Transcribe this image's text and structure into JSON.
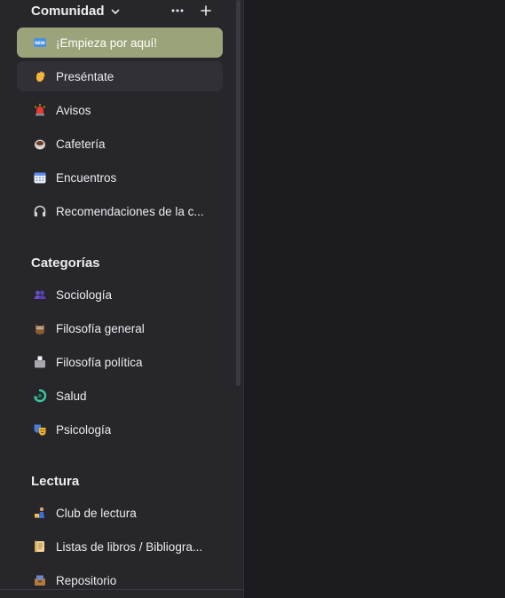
{
  "community": {
    "title": "Comunidad",
    "items": [
      {
        "label": "¡Empieza por aquí!",
        "icon": "new-badge-icon",
        "state": "active"
      },
      {
        "label": "Preséntate",
        "icon": "waving-hand-icon",
        "state": "hover"
      },
      {
        "label": "Avisos",
        "icon": "siren-icon",
        "state": ""
      },
      {
        "label": "Cafetería",
        "icon": "coffee-icon",
        "state": ""
      },
      {
        "label": "Encuentros",
        "icon": "calendar-icon",
        "state": ""
      },
      {
        "label": "Recomendaciones de la c...",
        "icon": "headphones-icon",
        "state": ""
      }
    ]
  },
  "categories": {
    "title": "Categorías",
    "items": [
      {
        "label": "Sociología",
        "icon": "people-icon"
      },
      {
        "label": "Filosofía general",
        "icon": "owl-icon"
      },
      {
        "label": "Filosofía política",
        "icon": "ballot-box-icon"
      },
      {
        "label": "Salud",
        "icon": "recycle-icon"
      },
      {
        "label": "Psicología",
        "icon": "theater-masks-icon"
      }
    ]
  },
  "reading": {
    "title": "Lectura",
    "items": [
      {
        "label": "Club de lectura",
        "icon": "reader-icon"
      },
      {
        "label": "Listas de libros / Bibliogra...",
        "icon": "scroll-icon"
      },
      {
        "label": "Repositorio",
        "icon": "card-box-icon"
      }
    ]
  },
  "colors": {
    "sidebar_bg": "#26262b",
    "main_bg": "#1c1c20",
    "active_bg": "#9aa37a",
    "hover_bg": "#303036",
    "text": "#ececf0"
  }
}
